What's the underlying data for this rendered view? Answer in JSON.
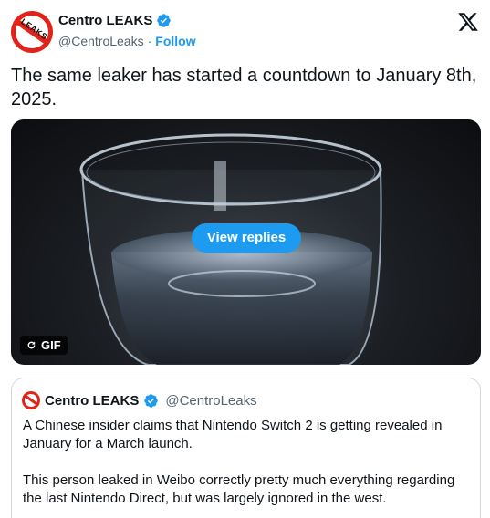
{
  "author": {
    "name": "Centro LEAKS",
    "handle": "@CentroLeaks",
    "separator": "·",
    "follow_label": "Follow",
    "avatar_text": "LEAKS"
  },
  "tweet": {
    "text": "The same leaker has started a countdown to January 8th, 2025."
  },
  "media": {
    "view_replies_label": "View replies",
    "gif_label": "GIF"
  },
  "quote": {
    "name": "Centro LEAKS",
    "handle": "@CentroLeaks",
    "paragraph_1": "A Chinese insider claims that Nintendo Switch 2 is getting revealed in January for a March launch.",
    "paragraph_2": "This person leaked in Weibo correctly pretty much everything regarding the last Nintendo Direct, but was largely ignored in the west."
  },
  "colors": {
    "accent": "#1d9bf0",
    "brand_red": "#e2231a",
    "muted": "#536471"
  }
}
